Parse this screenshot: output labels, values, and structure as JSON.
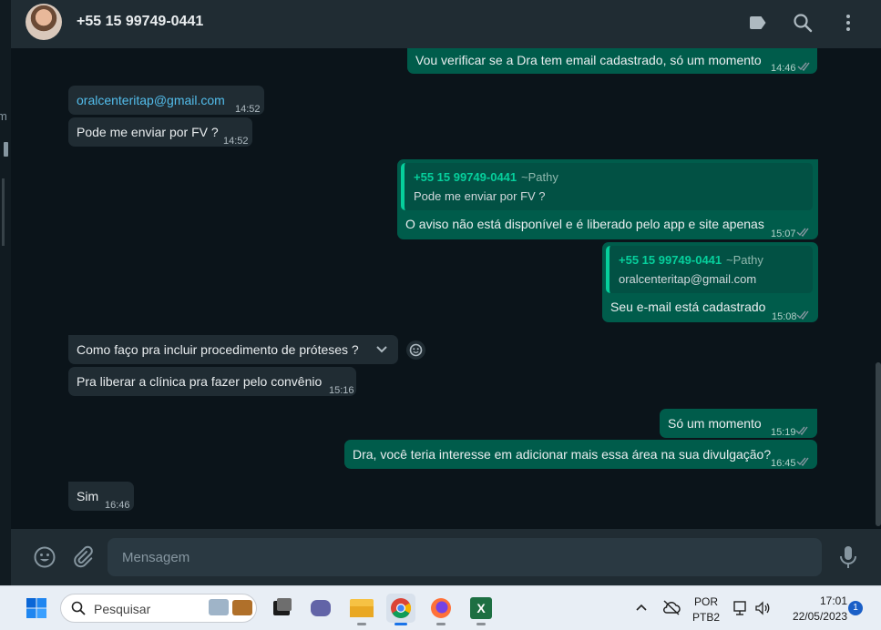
{
  "header": {
    "contact_name": "+55 15 99749-0441"
  },
  "messages": [
    {
      "dir": "out",
      "text": "Vou verificar se a Dra tem email cadastrado, só um momento",
      "time": "14:46"
    },
    {
      "dir": "in",
      "text": "oralcenteritap@gmail.com",
      "time": "14:52",
      "link": true
    },
    {
      "dir": "in",
      "text": "Pode me enviar por FV ?",
      "time": "14:52"
    },
    {
      "dir": "out",
      "quote_name": "+55 15 99749-0441",
      "quote_push": "~Pathy",
      "quote_text": "Pode me enviar por FV ?",
      "text": "O aviso não está disponível e é liberado pelo app e site apenas",
      "time": "15:07"
    },
    {
      "dir": "out",
      "quote_name": "+55 15 99749-0441",
      "quote_push": "~Pathy",
      "quote_text": "oralcenteritap@gmail.com",
      "text": "Seu e-mail está cadastrado",
      "time": "15:08"
    },
    {
      "dir": "in",
      "text": "Como faço pra incluir procedimento de próteses ?",
      "time": ""
    },
    {
      "dir": "in",
      "text": "Pra liberar a clínica pra fazer pelo convênio",
      "time": "15:16"
    },
    {
      "dir": "out",
      "text": "Só um momento",
      "time": "15:19"
    },
    {
      "dir": "out",
      "text": "Dra, você teria interesse em adicionar mais essa área na sua divulgação?",
      "time": "16:45"
    },
    {
      "dir": "in",
      "text": "Sim",
      "time": "16:46"
    }
  ],
  "composer": {
    "placeholder": "Mensagem"
  },
  "taskbar": {
    "search_placeholder": "Pesquisar",
    "lang_top": "POR",
    "lang_bottom": "PTB2",
    "time": "17:01",
    "date": "22/05/2023",
    "notification_count": "1"
  },
  "left_strip": {
    "fragment": "m"
  },
  "colors": {
    "incoming": "#202c33",
    "outgoing": "#005c4b",
    "accent": "#06cf9c",
    "link": "#53bdeb",
    "ticks": "#8696a0"
  }
}
